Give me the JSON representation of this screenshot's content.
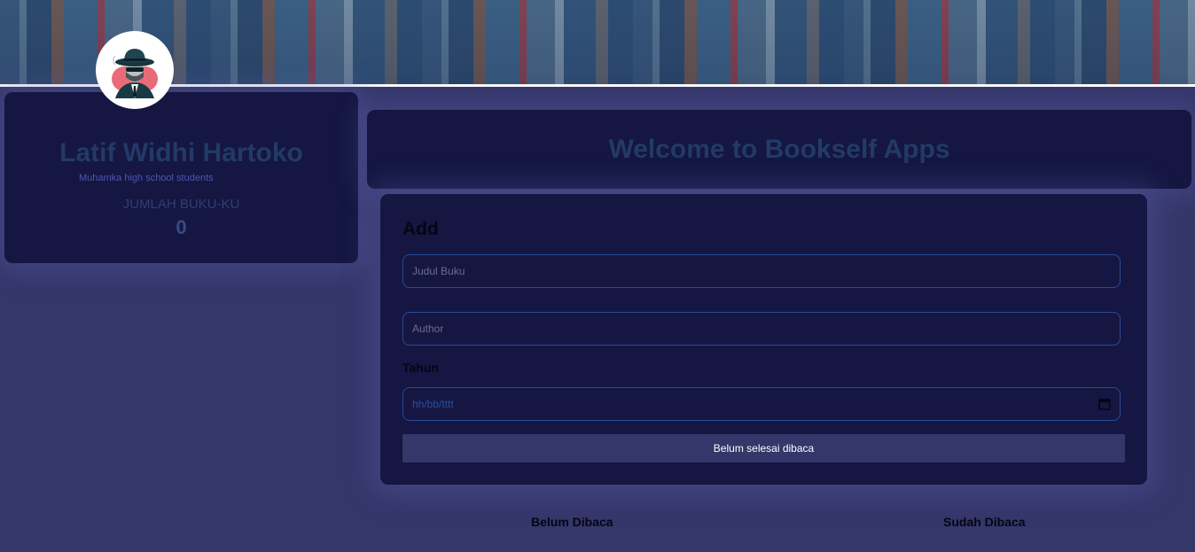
{
  "profile": {
    "name": "Latif Widhi Hartoko",
    "role": "Muhamka high school students",
    "count_label": "JUMLAH BUKU-KU",
    "count_value": "0",
    "avatar_icon": "spy-avatar-icon"
  },
  "header": {
    "welcome_title": "Welcome to Bookself Apps"
  },
  "form": {
    "title": "Add",
    "title_placeholder": "Judul Buku",
    "author_placeholder": "Author",
    "year_label": "Tahun",
    "date_placeholder": "hh/bb/tttt",
    "submit_label": "Belum selesai dibaca"
  },
  "shelves": {
    "unread_heading": "Belum Dibaca",
    "read_heading": "Sudah Dibaca"
  },
  "colors": {
    "page_background": "#35366a",
    "card_background": "#151641",
    "input_border": "#2a4a9a",
    "heading_muted": "#223a66"
  }
}
